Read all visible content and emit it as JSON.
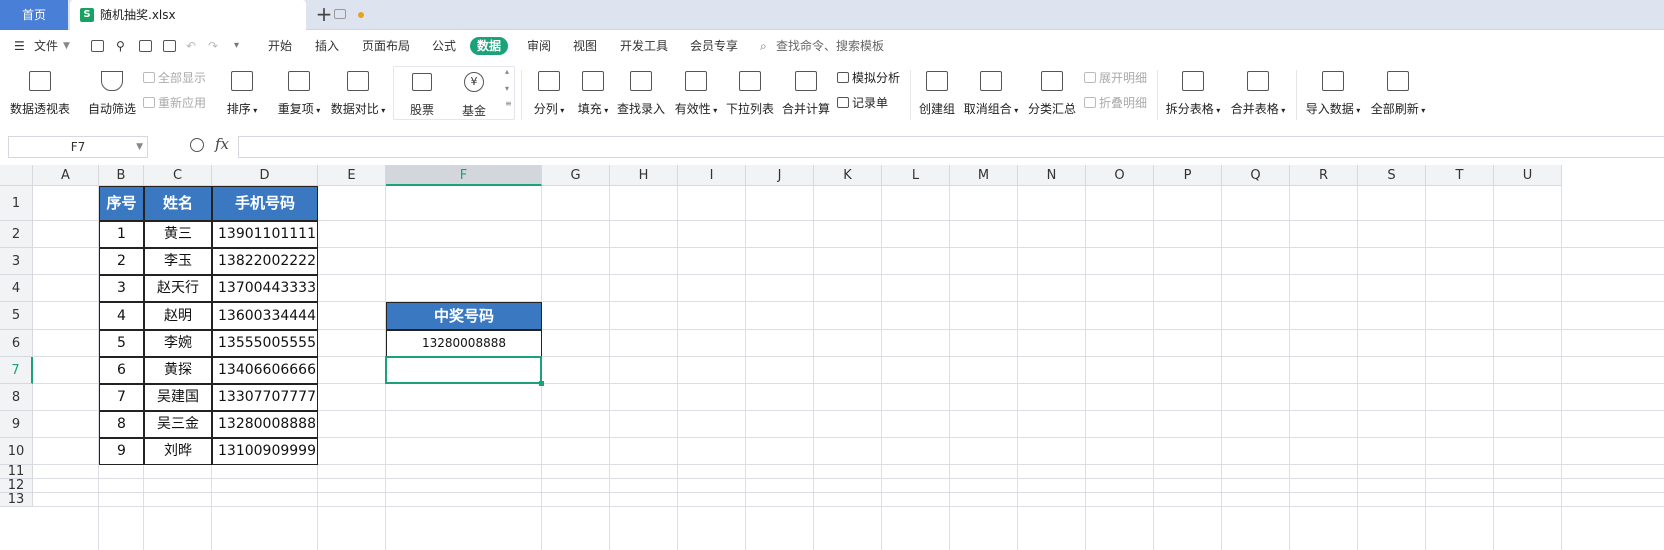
{
  "tabs": {
    "home": "首页",
    "file_name": "随机抽奖.xlsx"
  },
  "menu": {
    "file": "文件",
    "items": [
      "开始",
      "插入",
      "页面布局",
      "公式",
      "数据",
      "审阅",
      "视图",
      "开发工具",
      "会员专享"
    ],
    "active": "数据",
    "search": "查找命令、搜索模板"
  },
  "ribbon": {
    "pivot": "数据透视表",
    "autofilter": "自动筛选",
    "show_all": "全部显示",
    "reapply": "重新应用",
    "sort": "排序",
    "duplicates": "重复项",
    "compare": "数据对比",
    "stocks": "股票",
    "funds": "基金",
    "split": "分列",
    "fill": "填充",
    "lookup": "查找录入",
    "validity": "有效性",
    "dropdown": "下拉列表",
    "consolidate": "合并计算",
    "simulate": "模拟分析",
    "record": "记录单",
    "group": "创建组",
    "ungroup": "取消组合",
    "subtotal": "分类汇总",
    "expand": "展开明细",
    "collapse": "折叠明细",
    "split_table": "拆分表格",
    "merge_table": "合并表格",
    "import": "导入数据",
    "refresh": "全部刷新"
  },
  "formula_bar": {
    "name_box": "F7",
    "fx": "fx",
    "content": ""
  },
  "columns": [
    "A",
    "B",
    "C",
    "D",
    "E",
    "F",
    "G",
    "H",
    "I",
    "J",
    "K",
    "L",
    "M",
    "N",
    "O",
    "P",
    "Q",
    "R",
    "S",
    "T",
    "U"
  ],
  "rows": [
    "1",
    "2",
    "3",
    "4",
    "5",
    "6",
    "7",
    "8",
    "9",
    "10",
    "11",
    "12",
    "13"
  ],
  "table": {
    "headers": [
      "序号",
      "姓名",
      "手机号码"
    ],
    "rows": [
      [
        "1",
        "黄三",
        "13901101111"
      ],
      [
        "2",
        "李玉",
        "13822002222"
      ],
      [
        "3",
        "赵天行",
        "13700443333"
      ],
      [
        "4",
        "赵明",
        "13600334444"
      ],
      [
        "5",
        "李婉",
        "13555005555"
      ],
      [
        "6",
        "黄探",
        "13406606666"
      ],
      [
        "7",
        "吴建国",
        "13307707777"
      ],
      [
        "8",
        "吴三金",
        "13280008888"
      ],
      [
        "9",
        "刘晔",
        "13100909999"
      ]
    ]
  },
  "winner": {
    "header": "中奖号码",
    "value": "13280008888"
  },
  "colors": {
    "header_fill": "#3a78c2",
    "accent": "#1aa37a",
    "home_tab": "#4a7fd8"
  }
}
